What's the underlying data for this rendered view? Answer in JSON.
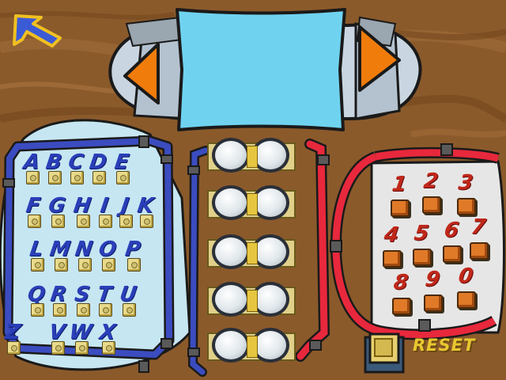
{
  "colors": {
    "table_wood": "#8a5a2a",
    "screen": "#6fd3f0",
    "arrow": "#f07c0c",
    "letter_panel": "#c6e6f2",
    "letter_pipe": "#3b4cc0",
    "number_pipe": "#e8283c",
    "reset_text": "#e8c830"
  },
  "nav": {
    "back_icon": "back-arrow-icon",
    "prev_icon": "arrow-left-icon",
    "next_icon": "arrow-right-icon"
  },
  "display": {
    "text": ""
  },
  "letters": [
    "A",
    "B",
    "C",
    "D",
    "E",
    "F",
    "G",
    "H",
    "I",
    "J",
    "K",
    "L",
    "M",
    "N",
    "O",
    "P",
    "Q",
    "R",
    "S",
    "T",
    "U",
    "V",
    "W",
    "X",
    "Y",
    "Z"
  ],
  "numbers": [
    "1",
    "2",
    "3",
    "4",
    "5",
    "6",
    "7",
    "8",
    "9",
    "0"
  ],
  "code_slots": [
    {
      "index": 1,
      "value": ""
    },
    {
      "index": 2,
      "value": ""
    },
    {
      "index": 3,
      "value": ""
    },
    {
      "index": 4,
      "value": ""
    },
    {
      "index": 5,
      "value": ""
    }
  ],
  "reset": {
    "label": "RESET"
  }
}
